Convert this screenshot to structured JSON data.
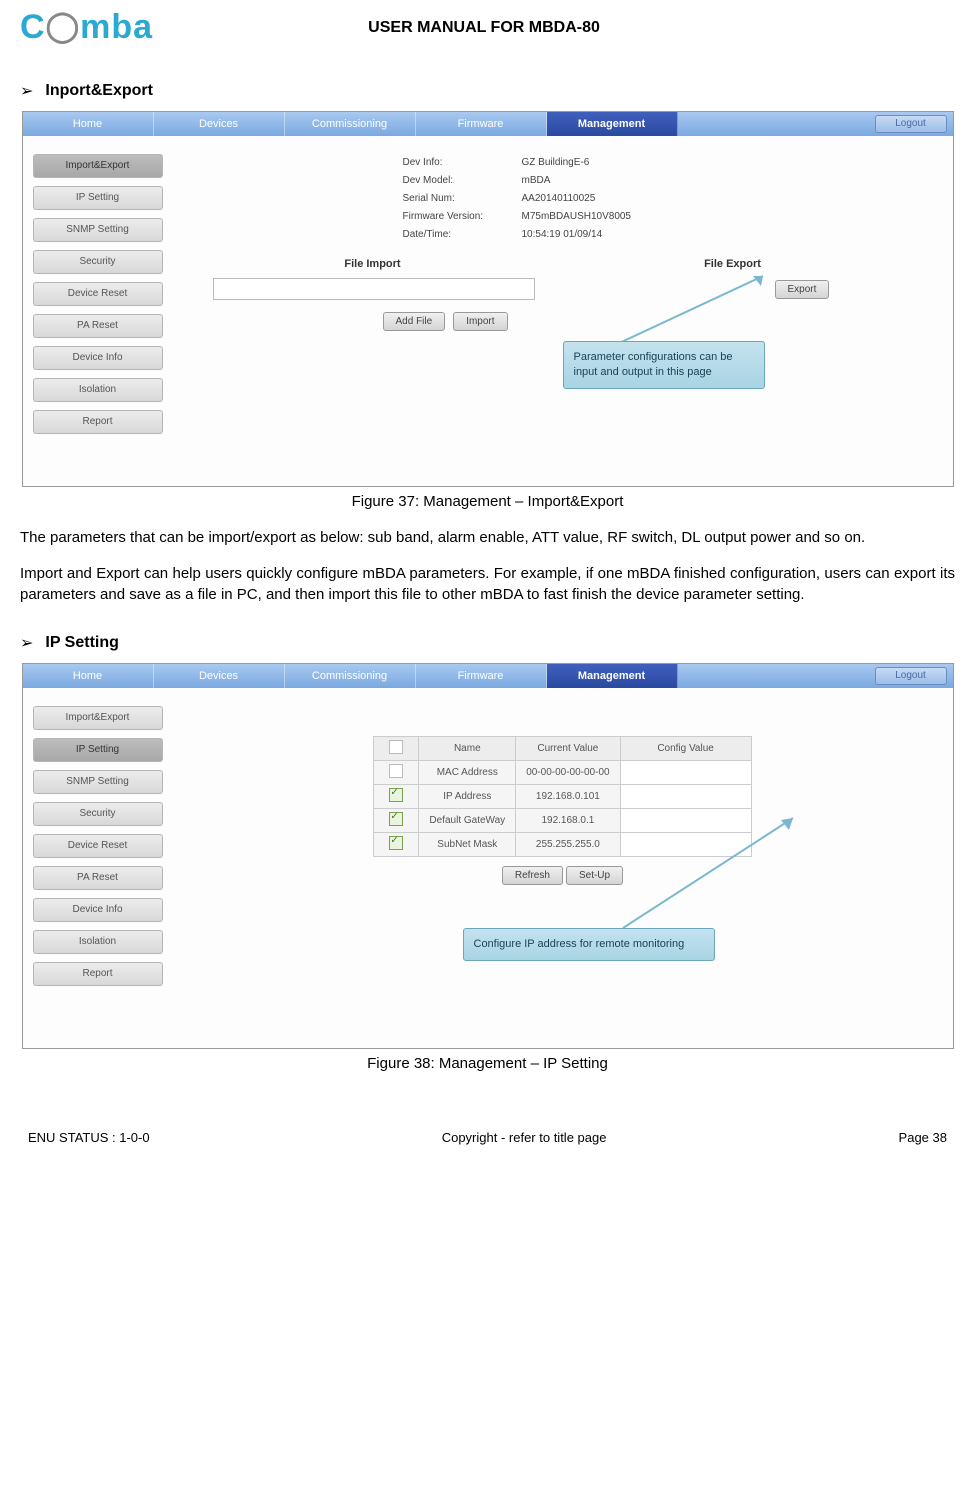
{
  "header": {
    "logo_text": "Comba",
    "title": "USER MANUAL FOR MBDA-80"
  },
  "sections": {
    "s1_title": "Inport&Export",
    "s2_title": "IP Setting"
  },
  "nav": {
    "items": [
      "Home",
      "Devices",
      "Commissioning",
      "Firmware",
      "Management"
    ],
    "logout": "Logout"
  },
  "sidebar": {
    "items": [
      "Import&Export",
      "IP Setting",
      "SNMP Setting",
      "Security",
      "Device Reset",
      "PA Reset",
      "Device Info",
      "Isolation",
      "Report"
    ]
  },
  "fig1": {
    "info": {
      "dev_info_label": "Dev Info:",
      "dev_info_value": "GZ BuildingE-6",
      "dev_model_label": "Dev Model:",
      "dev_model_value": "mBDA",
      "serial_label": "Serial Num:",
      "serial_value": "AA20140110025",
      "fw_label": "Firmware Version:",
      "fw_value": "M75mBDAUSH10V8005",
      "dt_label": "Date/Time:",
      "dt_value": "10:54:19 01/09/14"
    },
    "file_import_header": "File Import",
    "file_export_header": "File Export",
    "add_file_btn": "Add File",
    "import_btn": "Import",
    "export_btn": "Export",
    "callout": "Parameter configurations can be input and output in this page"
  },
  "fig2": {
    "table": {
      "headers": {
        "name": "Name",
        "current": "Current Value",
        "config": "Config Value"
      },
      "rows": [
        {
          "checked": "empty",
          "name": "MAC Address",
          "current": "00-00-00-00-00-00",
          "config": ""
        },
        {
          "checked": "checked",
          "name": "IP Address",
          "current": "192.168.0.101",
          "config": ""
        },
        {
          "checked": "checked",
          "name": "Default GateWay",
          "current": "192.168.0.1",
          "config": ""
        },
        {
          "checked": "checked",
          "name": "SubNet Mask",
          "current": "255.255.255.0",
          "config": ""
        }
      ]
    },
    "refresh_btn": "Refresh",
    "setup_btn": "Set-Up",
    "callout": "Configure IP address for remote monitoring"
  },
  "captions": {
    "fig1": "Figure 37: Management – Import&Export",
    "fig2": "Figure 38: Management – IP Setting"
  },
  "body": {
    "p1": "The parameters that can be import/export as below: sub band, alarm enable, ATT value, RF switch, DL output power and so on.",
    "p2": "Import and Export can help users quickly configure mBDA parameters. For example, if one mBDA finished configuration, users can export its parameters and save as a file in PC, and then import this file to other mBDA to fast finish the device parameter setting."
  },
  "footer": {
    "left": "ENU STATUS : 1-0-0",
    "center": "Copyright - refer to title page",
    "right": "Page 38"
  }
}
